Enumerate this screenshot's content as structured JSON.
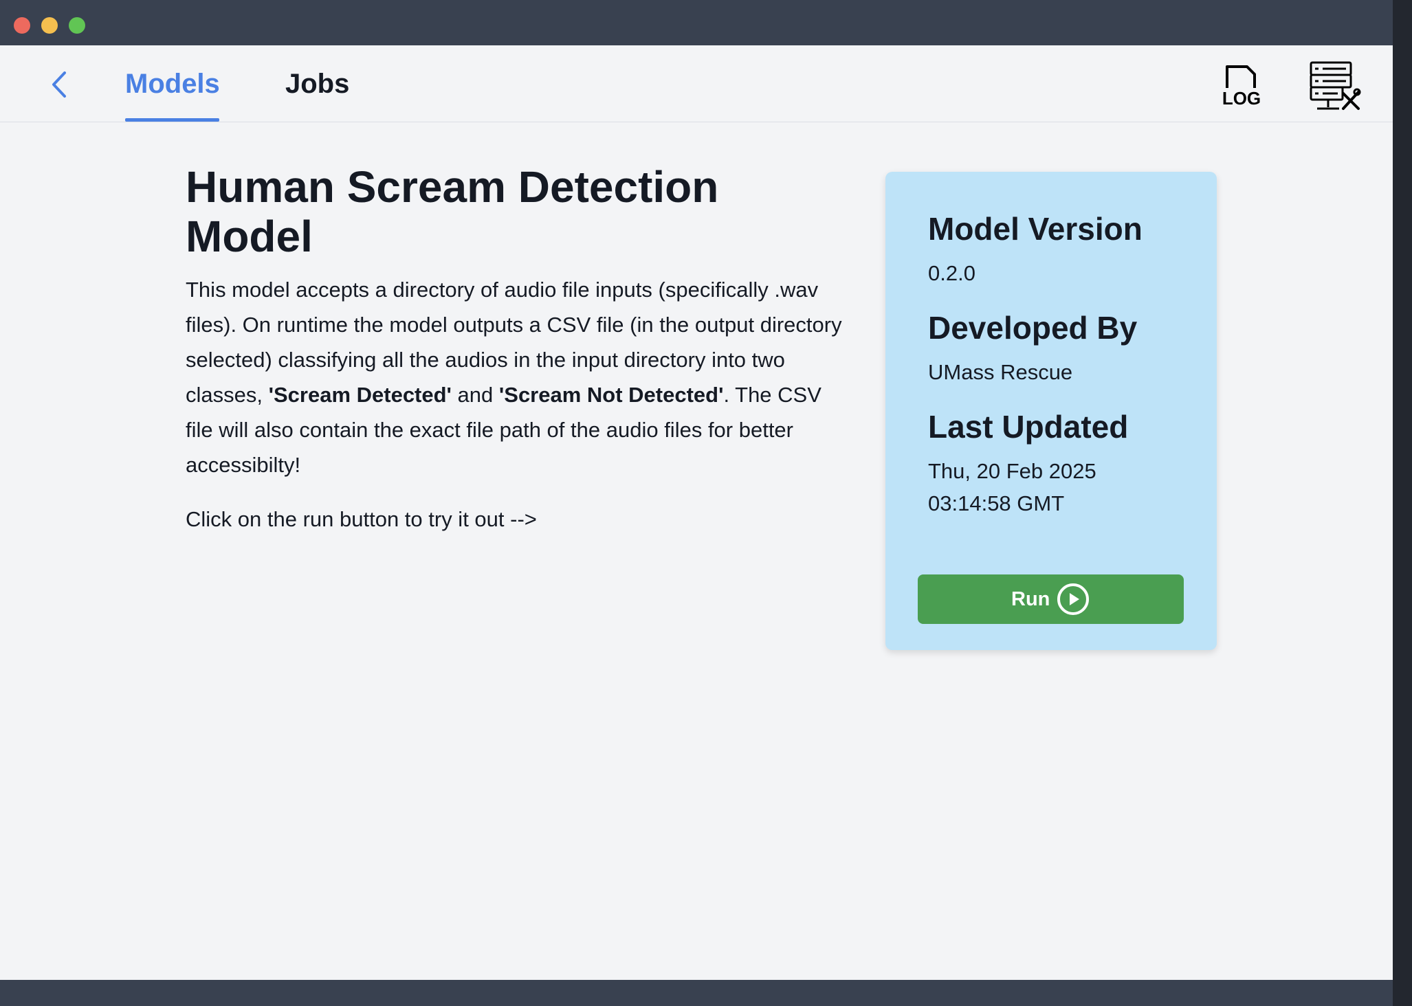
{
  "nav": {
    "tabs": [
      {
        "label": "Models",
        "active": true
      },
      {
        "label": "Jobs",
        "active": false
      }
    ],
    "log_label": "LOG",
    "icons": [
      "chevron-left-icon",
      "log-file-icon",
      "server-settings-icon"
    ]
  },
  "main": {
    "title": "Human Scream Detection Model",
    "description": {
      "part1": "This model accepts a directory of audio file inputs (specifically .wav files). On runtime the model outputs a CSV file (in the output directory selected) classifying all the audios in the input directory into two classes, ",
      "bold1": "'Scream Detected'",
      "part2": " and ",
      "bold2": "'Scream Not Detected'",
      "part3": ". The CSV file will also contain the exact file path of the audio files for better accessibilty!"
    },
    "cta": "Click on the run button to try it out -->"
  },
  "card": {
    "version_heading": "Model Version",
    "version_value": "0.2.0",
    "developer_heading": "Developed By",
    "developer_value": "UMass Rescue",
    "updated_heading": "Last Updated",
    "updated_value": "Thu, 20 Feb 2025 03:14:58 GMT",
    "run_label": "Run"
  },
  "colors": {
    "accent": "#4a80e3",
    "card_bg": "#bee3f8",
    "run_button": "#4a9e51",
    "titlebar": "#394150"
  }
}
